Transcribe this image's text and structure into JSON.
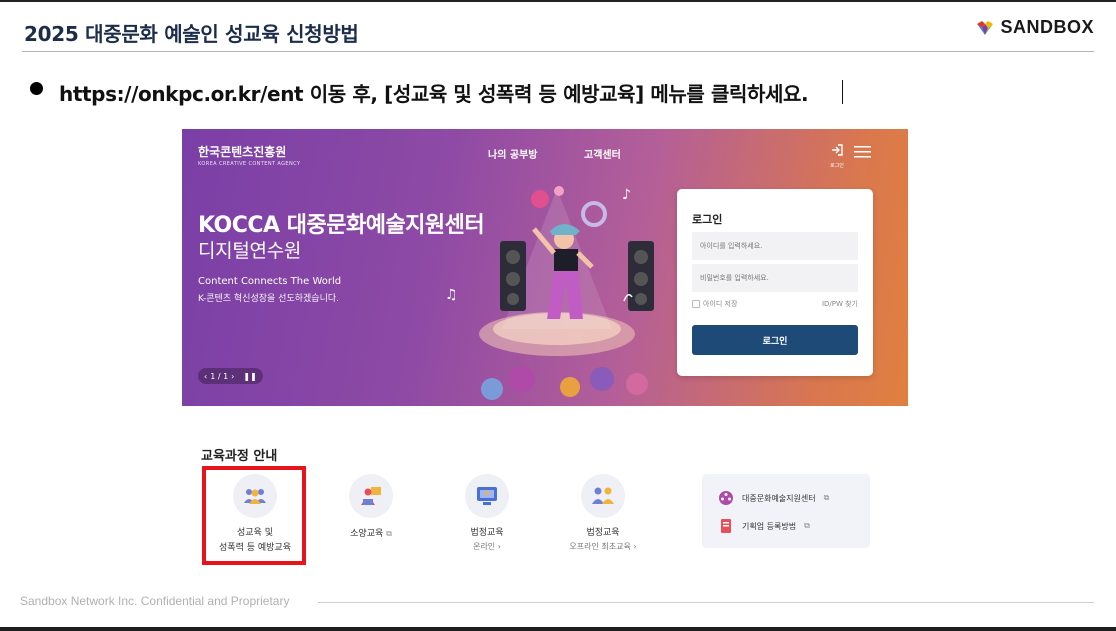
{
  "slide": {
    "title": "2025 대중문화 예술인 성교육 신청방법",
    "brand": "SANDBOX",
    "instruction": "https://onkpc.or.kr/ent 이동 후, [성교육 및 성폭력 등 예방교육] 메뉴를 클릭하세요.",
    "footer": "Sandbox Network Inc. Confidential and Proprietary"
  },
  "site": {
    "logo_main": "한국콘텐츠진흥원",
    "logo_sub": "KOREA CREATIVE CONTENT AGENCY",
    "nav": [
      "나의 공부방",
      "고객센터"
    ],
    "login_icon_label": "로그인",
    "hero_title": "KOCCA 대중문화예술지원센터",
    "hero_subtitle": "디지털연수원",
    "hero_tagline": "Content Connects The World",
    "hero_desc": "K-콘텐츠 혁신성장을 선도하겠습니다.",
    "pager": "1 / 1",
    "login": {
      "title": "로그인",
      "id_placeholder": "아이디를 입력하세요.",
      "pw_placeholder": "비밀번호를 입력하세요.",
      "remember": "아이디 저장",
      "find": "ID/PW 찾기",
      "button": "로그인"
    }
  },
  "courses": {
    "heading": "교육과정 안내",
    "items": [
      {
        "line1": "성교육 및",
        "line2": "성폭력 등 예방교육",
        "sub": ""
      },
      {
        "line1": "소양교육",
        "line2": "",
        "sub": ""
      },
      {
        "line1": "법정교육",
        "line2": "",
        "sub": "온라인"
      },
      {
        "line1": "법정교육",
        "line2": "",
        "sub": "오프라인 최초교육"
      }
    ],
    "side_links": [
      "대중문화예술지원센터",
      "기획업 등록방법"
    ]
  },
  "colors": {
    "title_navy": "#1c2d4a",
    "highlight_red": "#e8141c",
    "login_button": "#1e4a78"
  }
}
